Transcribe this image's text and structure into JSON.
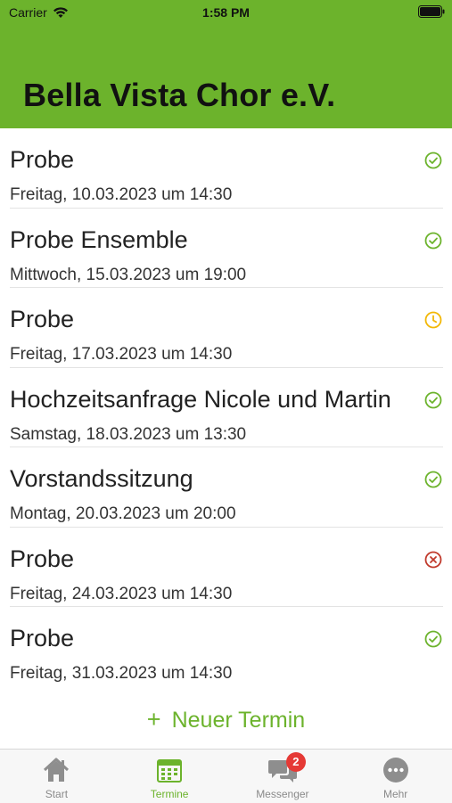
{
  "status_bar": {
    "carrier": "Carrier",
    "time": "1:58 PM"
  },
  "header": {
    "title": "Bella Vista Chor e.V."
  },
  "events": [
    {
      "title": "Probe",
      "date": "Freitag, 10.03.2023 um 14:30",
      "status": "confirmed"
    },
    {
      "title": "Probe Ensemble",
      "date": "Mittwoch, 15.03.2023 um 19:00",
      "status": "confirmed"
    },
    {
      "title": "Probe",
      "date": "Freitag, 17.03.2023 um 14:30",
      "status": "pending"
    },
    {
      "title": "Hochzeitsanfrage Nicole und Martin",
      "date": "Samstag, 18.03.2023 um 13:30",
      "status": "confirmed"
    },
    {
      "title": "Vorstandssitzung",
      "date": "Montag, 20.03.2023 um 20:00",
      "status": "confirmed"
    },
    {
      "title": "Probe",
      "date": "Freitag, 24.03.2023 um 14:30",
      "status": "declined"
    },
    {
      "title": "Probe",
      "date": "Freitag, 31.03.2023 um 14:30",
      "status": "confirmed"
    }
  ],
  "new_event": {
    "label": "Neuer Termin",
    "icon": "plus-icon"
  },
  "tabs": [
    {
      "label": "Start",
      "icon": "home-icon",
      "active": false
    },
    {
      "label": "Termine",
      "icon": "calendar-icon",
      "active": true
    },
    {
      "label": "Messenger",
      "icon": "chat-bubbles-icon",
      "active": false,
      "badge": "2"
    },
    {
      "label": "Mehr",
      "icon": "more-icon",
      "active": false
    }
  ],
  "colors": {
    "accent": "#6cb32c",
    "confirmed": "#6cb32c",
    "pending": "#f2b705",
    "declined": "#c0392b",
    "badge": "#e53935"
  }
}
